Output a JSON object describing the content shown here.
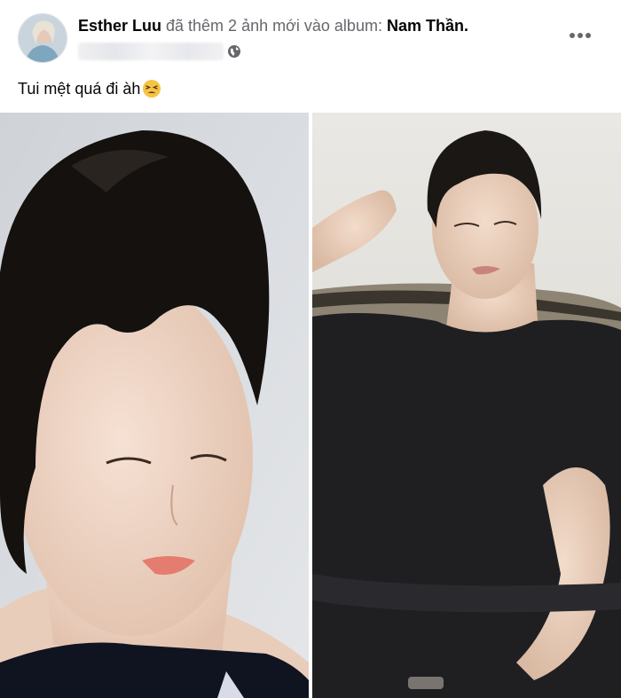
{
  "post": {
    "author_name": "Esther Luu",
    "action_text": " đã thêm 2 ảnh mới vào album: ",
    "album_name": "Nam Thần.",
    "caption": "Tui mệt quá đi àh",
    "caption_emoji": "tired-face-emoji",
    "privacy_icon": "globe-icon",
    "menu_icon": "more-horizontal-icon"
  },
  "colors": {
    "text": "#050505",
    "secondary_text": "#65676b",
    "emoji": "#f6c343",
    "background": "#ffffff"
  }
}
